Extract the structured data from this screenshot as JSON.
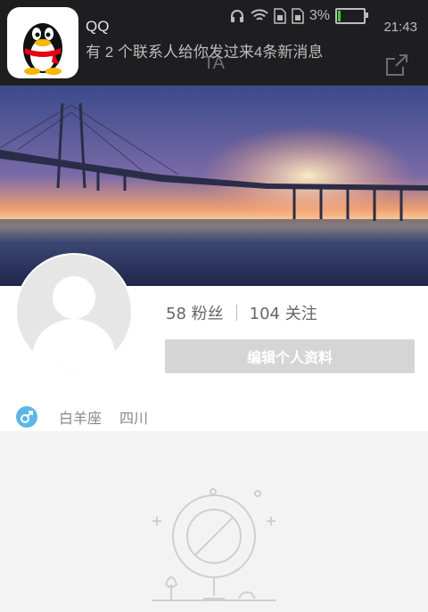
{
  "status_bar": {
    "battery_percent": "3%",
    "time": "21:43"
  },
  "header": {
    "title": "TA"
  },
  "notification": {
    "app_name": "QQ",
    "message": "有 2 个联系人给你发过来4条新消息"
  },
  "profile": {
    "fans_count": "58",
    "fans_label": "粉丝",
    "follow_count": "104",
    "follow_label": "关注",
    "edit_button": "编辑个人资料",
    "constellation": "白羊座",
    "location": "四川"
  },
  "colors": {
    "app_bar": "#1e1e20",
    "gender_badge": "#5bb7e6",
    "button_bg": "#d5d5d5"
  }
}
